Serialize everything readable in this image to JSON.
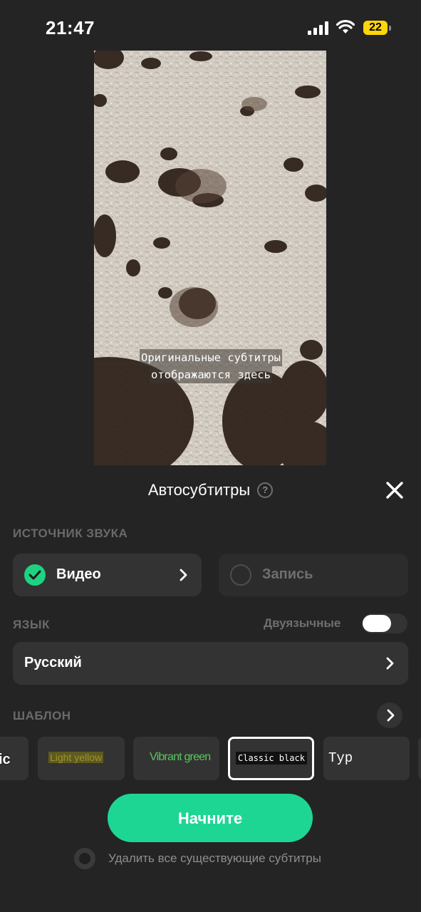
{
  "status_bar": {
    "time": "21:47",
    "battery": "22"
  },
  "video": {
    "subtitle_lines": [
      "Оригинальные субтитры",
      "отображаются здесь"
    ]
  },
  "sheet": {
    "title": "Автосубтитры",
    "help_icon": "?",
    "sound_source_label": "ИСТОЧНИК ЗВУКА",
    "source_options": [
      {
        "label": "Видео",
        "selected": true
      },
      {
        "label": "Запись",
        "selected": false
      }
    ],
    "language_label": "ЯЗЫК",
    "bilingual_label": "Двуязычные",
    "bilingual_enabled": false,
    "language_value": "Русский",
    "template_label": "ШАБЛОН",
    "templates": [
      {
        "label": "ic",
        "color": "#ffffff"
      },
      {
        "label": "Light yellow",
        "color": "#8f8a2a",
        "bg": "#6a6624"
      },
      {
        "label": "Vibrant green",
        "color": "#57c85a"
      },
      {
        "label": "Classic black",
        "color": "#ffffff",
        "bg": "#111111",
        "selected": true
      },
      {
        "label": "Typ",
        "color": "#ffffff"
      },
      {
        "label": "",
        "color": "#ffffff"
      }
    ],
    "start_button": "Начните",
    "remove_existing_label": "Удалить все существующие субтитры"
  },
  "colors": {
    "accent": "#1ed694",
    "check": "#1ed37f",
    "battery": "#ffd60a",
    "background": "#242424"
  }
}
